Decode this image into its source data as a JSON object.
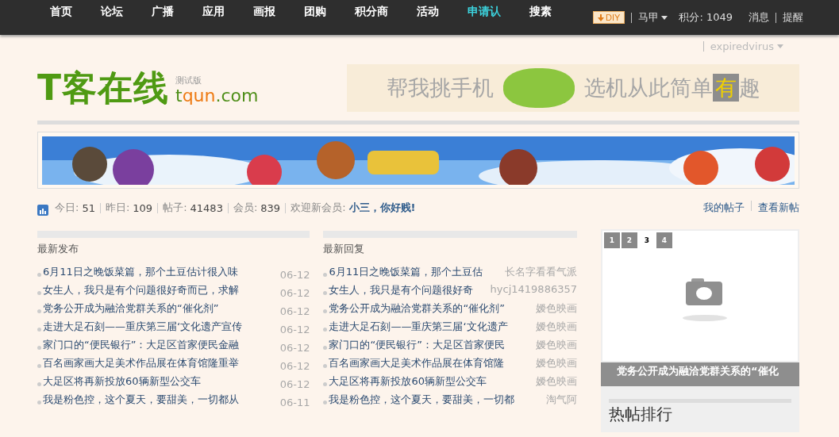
{
  "top_nav": {
    "items": [
      {
        "label": "首页",
        "selected": false
      },
      {
        "label": "论坛",
        "selected": false
      },
      {
        "label": "广播",
        "selected": false
      },
      {
        "label": "应用",
        "selected": false
      },
      {
        "label": "画报",
        "selected": false
      },
      {
        "label": "团购",
        "selected": false
      },
      {
        "label": "积分商",
        "selected": false
      },
      {
        "label": "活动",
        "selected": false
      },
      {
        "label": "申请认",
        "selected": true
      },
      {
        "label": "搜素",
        "selected": false
      }
    ],
    "diy_button": "DIY",
    "user_menu": "马甲",
    "points": "积分: 1049",
    "messages": "消息",
    "reminders": "提醒"
  },
  "account_menu": "expiredvirus",
  "logo": {
    "name": "T客在线",
    "badge": "测试版",
    "domain_highlight": "qun",
    "domain_start": "t",
    "domain_end": ".com"
  },
  "ad_banner": {
    "left_text": "帮我挑手机",
    "right_text_start": "选机从此简单",
    "highlight": "有",
    "right_text_end": "趣"
  },
  "stats": [
    {
      "label": "今日:",
      "value": "51"
    },
    {
      "label": "昨日:",
      "value": "109"
    },
    {
      "label": "帖子:",
      "value": "41483"
    },
    {
      "label": "会员:",
      "value": "839"
    }
  ],
  "welcome": {
    "label": "欢迎新会员:",
    "name": "小三，你好贱!"
  },
  "quick_links": [
    "我的帖子",
    "查看新帖"
  ],
  "latest_posts": {
    "title": "最新发布",
    "rows": [
      {
        "title": "6月11日之晚饭菜篇，那个土豆估计很入味",
        "meta": "06-12"
      },
      {
        "title": "女生人，我只是有个问题很好奇而已，求解",
        "meta": "06-12"
      },
      {
        "title": "党务公开成为融洽党群关系的“催化剂”",
        "meta": "06-12"
      },
      {
        "title": "走进大足石刻——重庆第三届‘文化遗产宣传",
        "meta": "06-12"
      },
      {
        "title": "家门口的“便民银行”：大足区首家便民金融",
        "meta": "06-12"
      },
      {
        "title": "百名画家画大足美术作品展在体育馆隆重举",
        "meta": "06-12"
      },
      {
        "title": "大足区将再新投放60辆新型公交车",
        "meta": "06-12"
      },
      {
        "title": "我是粉色控，这个夏天，要甜美，一切都从",
        "meta": "06-11"
      }
    ]
  },
  "latest_replies": {
    "title": "最新回复",
    "rows": [
      {
        "title": "6月11日之晚饭菜篇，那个土豆估",
        "meta": "长名字看看气派"
      },
      {
        "title": "女生人，我只是有个问题很好奇",
        "meta": "hycj1419886357"
      },
      {
        "title": "党务公开成为融洽党群关系的“催化剂”",
        "meta": "嫒色映画"
      },
      {
        "title": "走进大足石刻——重庆第三届‘文化遗产",
        "meta": "嫒色映画"
      },
      {
        "title": "家门口的“便民银行”：大足区首家便民",
        "meta": "嫒色映画"
      },
      {
        "title": "百名画家画大足美术作品展在体育馆隆",
        "meta": "嫒色映画"
      },
      {
        "title": "大足区将再新投放60辆新型公交车",
        "meta": "嫒色映画"
      },
      {
        "title": "我是粉色控，这个夏天，要甜美，一切都",
        "meta": "淘气阿"
      }
    ]
  },
  "slideshow": {
    "pages": [
      {
        "label": "1",
        "selected": false
      },
      {
        "label": "2",
        "selected": false
      },
      {
        "label": "3",
        "selected": true
      },
      {
        "label": "4",
        "selected": false
      }
    ],
    "caption": "党务公开成为融洽党群关系的“催化"
  },
  "hot_posts": {
    "title": "热帖排行"
  }
}
